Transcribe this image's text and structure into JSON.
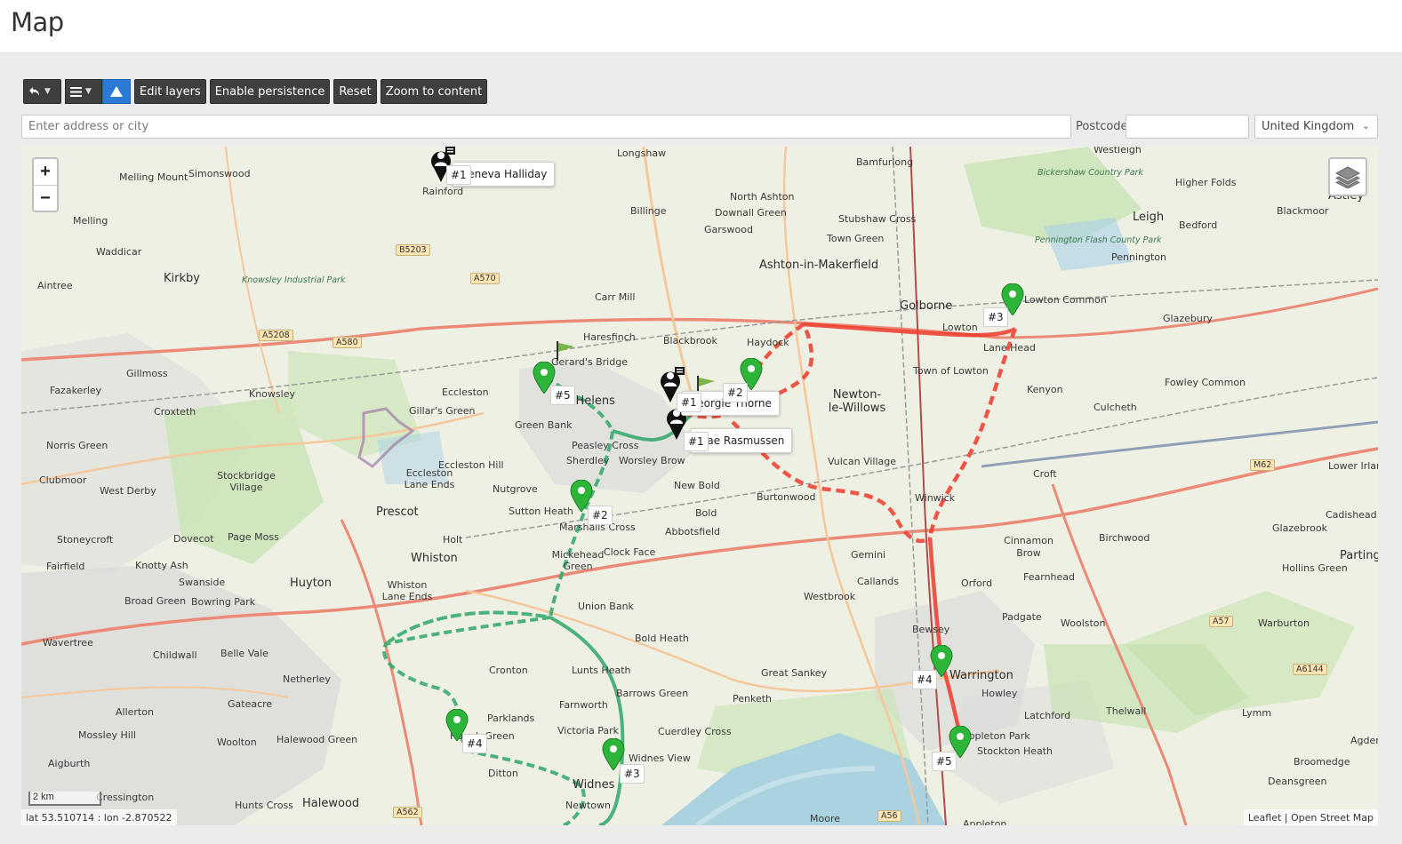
{
  "page": {
    "title": "Map"
  },
  "toolbar": {
    "undo_icon": "undo-icon",
    "menu_icon": "menu-icon",
    "triangle_icon": "triangle-icon",
    "edit_layers": "Edit layers",
    "enable_persistence": "Enable persistence",
    "reset": "Reset",
    "zoom_to_content": "Zoom to content"
  },
  "search": {
    "address_placeholder": "Enter address or city",
    "address_value": "",
    "postcode_label": "Postcode",
    "postcode_value": "",
    "country_selected": "United Kingdom"
  },
  "colors": {
    "red_route": "#ef3b2c",
    "green_route": "#2fa86b",
    "pin_green": "#2db53a"
  },
  "map": {
    "zoom_in": "+",
    "zoom_out": "−",
    "scale_label": "2 km",
    "coords_readout": "lat 53.510714 : lon -2.870522",
    "attribution": "Leaflet | Open Street Map",
    "places": [
      "Longshaw",
      "Westleigh",
      "Bamfurlong",
      "Melling Mount",
      "Simonswood",
      "Rainford",
      "North Ashton",
      "Downall Green",
      "Billinge",
      "Garswood",
      "Stubshaw Cross",
      "Town Green",
      "Bickershaw Country Park",
      "Higher Folds",
      "Astley",
      "Leigh",
      "Bedford",
      "Blackmoor",
      "Melling",
      "Waddicar",
      "Kirkby",
      "Knowsley Industrial Park",
      "Aintree",
      "Ashton-in-Makerfield",
      "Golborne",
      "Pennington Flash County Park",
      "Pennington",
      "Carr Mill",
      "Lowton Common",
      "Glazebury",
      "Lowton",
      "Haresfinch",
      "Blackbrook",
      "Haydock",
      "Lane Head",
      "Gillmoss",
      "Gerard's Bridge",
      "Town of Lowton",
      "Fazakerley",
      "Knowsley",
      "Eccleston",
      "Newton-le-Willows",
      "Kenyon",
      "Fowley Common",
      "Croxteth",
      "Gillar's Green",
      "St Helens",
      "Culcheth",
      "Green Bank",
      "Norris Green",
      "Peasley Cross",
      "Sherdley",
      "Worsley Brow",
      "Vulcan Village",
      "Eccleston Hill",
      "Croft",
      "Clubmoor",
      "Stockbridge Village",
      "Eccleston Lane Ends",
      "West Derby",
      "Nutgrove",
      "New Bold",
      "Burtonwood",
      "Winwick",
      "Lower Irlam",
      "Prescot",
      "Sutton Heath",
      "Bold",
      "Marshalls Cross",
      "Abbotsfield",
      "Cadishead",
      "Stoneycroft",
      "Dovecot",
      "Page Moss",
      "Holt",
      "Cinnamon Brow",
      "Birchwood",
      "Glazebrook",
      "Fairfield",
      "Knotty Ash",
      "Whiston",
      "Mickehead Green",
      "Clock Face",
      "Gemini",
      "Partington",
      "Swanside",
      "Huyton",
      "Whiston Lane Ends",
      "Callands",
      "Orford",
      "Fearnhead",
      "Hollins Green",
      "Broad Green",
      "Bowring Park",
      "Union Bank",
      "Westbrook",
      "Padgate",
      "Woolston",
      "Warburton",
      "Wavertree",
      "Bewsey",
      "Childwall",
      "Belle Vale",
      "Bold Heath",
      "Netherley",
      "Cronton",
      "Lunts Heath",
      "Great Sankey",
      "Warrington",
      "Howley",
      "Gateacre",
      "Barrows Green",
      "Latchford",
      "Thelwall",
      "Lymm",
      "Allerton",
      "Farnworth",
      "Penketh",
      "Mossley Hill",
      "Parklands",
      "Victoria Park",
      "Cuerdley Cross",
      "Woolton",
      "Halewood Green",
      "Appleton Park",
      "Agden",
      "Aigburth",
      "Widnes View",
      "Stockton Heath",
      "Broomedge",
      "Ditton",
      "Widnes",
      "Hough Green",
      "Deansgreen",
      "Cressington",
      "Hunts Cross",
      "Halewood",
      "Newtown",
      "Moore",
      "Appleton"
    ],
    "roads": [
      "B5203",
      "A570",
      "A5208",
      "A580",
      "A562",
      "A56",
      "A57",
      "A6144",
      "M62"
    ],
    "markers": [
      {
        "label": "#1",
        "name": "Geneva Halliday"
      },
      {
        "label": "#5"
      },
      {
        "label": "#1",
        "name": "Georgie Thorne"
      },
      {
        "label": "#2"
      },
      {
        "label": "#1",
        "name": "Mae Rasmussen"
      },
      {
        "label": "#2"
      },
      {
        "label": "#3"
      },
      {
        "label": "#4"
      },
      {
        "label": "#4"
      },
      {
        "label": "#3"
      },
      {
        "label": "#5"
      }
    ]
  }
}
